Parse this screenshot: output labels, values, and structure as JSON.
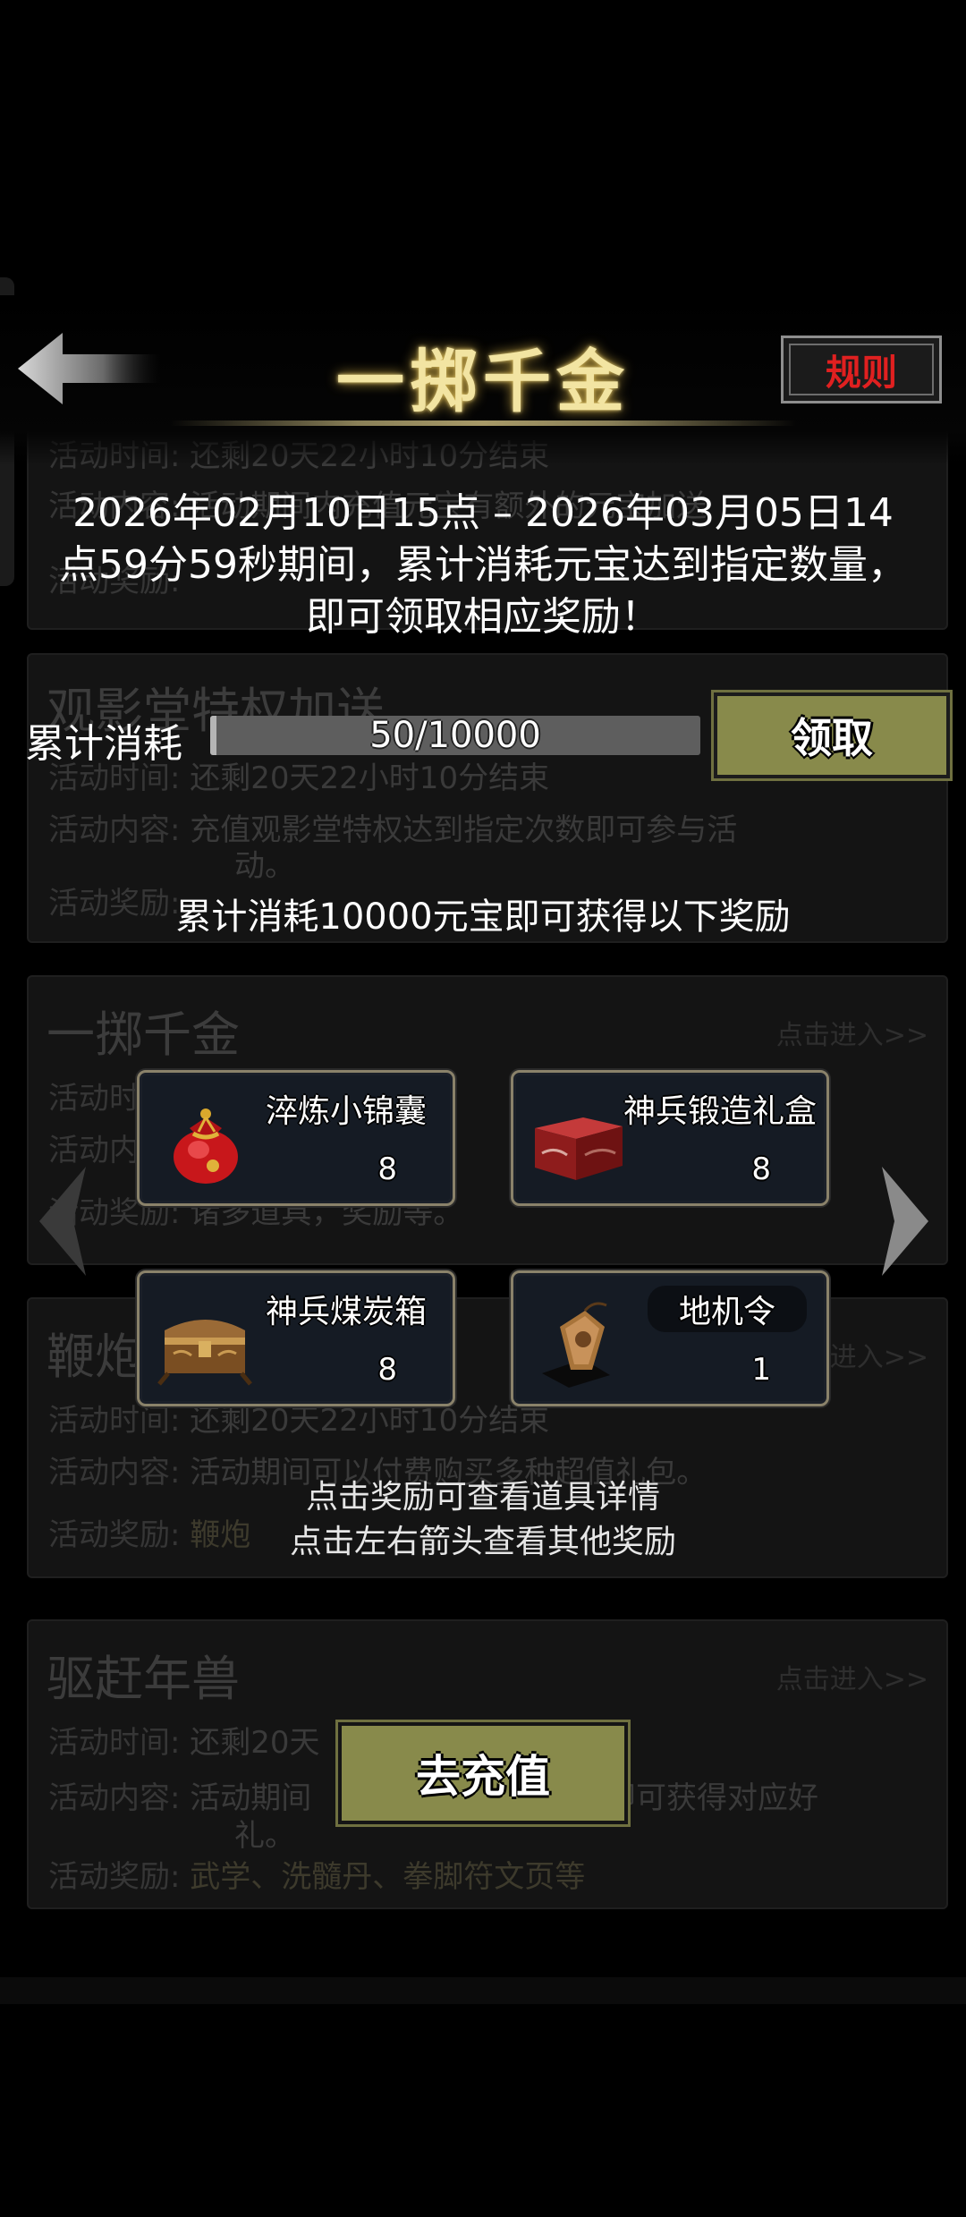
{
  "header": {
    "title": "一掷千金",
    "rules_label": "规则"
  },
  "event": {
    "description": "2026年02月10日15点 – 2026年03月05日14点59分59秒期间，累计消耗元宝达到指定数量，即可领取相应奖励！"
  },
  "progress": {
    "label": "累计消耗",
    "current": 50,
    "target": 10000,
    "text": "50/10000",
    "claim_label": "领取"
  },
  "reward_caption": "累计消耗10000元宝即可获得以下奖励",
  "rewards": [
    {
      "name": "淬炼小锦囊",
      "count": "8",
      "icon": "red-pouch-icon"
    },
    {
      "name": "神兵锻造礼盒",
      "count": "8",
      "icon": "red-giftbox-icon"
    },
    {
      "name": "神兵煤炭箱",
      "count": "8",
      "icon": "treasure-chest-icon"
    },
    {
      "name": "地机令",
      "count": "1",
      "icon": "token-tablet-icon"
    }
  ],
  "hints": {
    "line1": "点击奖励可查看道具详情",
    "line2": "点击左右箭头查看其他奖励"
  },
  "recharge_label": "去充值",
  "background_list": {
    "key_time": "活动时间:",
    "key_content": "活动内容:",
    "key_reward": "活动奖励:",
    "enter_link": "点击进入>>",
    "card0": {
      "time": "还剩20天22小时10分结束",
      "content": "活动期间内充值元宝有额外的元宝加送"
    },
    "card1": {
      "title": "观影堂特权加送",
      "time": "还剩20天22小时10分结束",
      "content_line1": "充值观影堂特权达到指定次数即可参与活",
      "content_line2": "动。"
    },
    "card2": {
      "title": "一掷千金",
      "reward": "诸多道具，奖励等。"
    },
    "card3": {
      "title": "鞭炮",
      "time": "还剩20天22小时10分结束",
      "content": "活动期间可以付费购买多种超值礼包。",
      "reward": "鞭炮"
    },
    "card4": {
      "title": "驱赶年兽",
      "time": "还剩20天",
      "content_line1": "活动期间",
      "content_line1b": "即可获得对应好",
      "content_line2": "礼。",
      "reward": "武学、洗髓丹、拳脚符文页等"
    }
  },
  "colors": {
    "title_gold": "#f2e4a2",
    "button_olive": "#888a4b",
    "rules_red": "#e02020",
    "reward_bg": "#151b24"
  }
}
